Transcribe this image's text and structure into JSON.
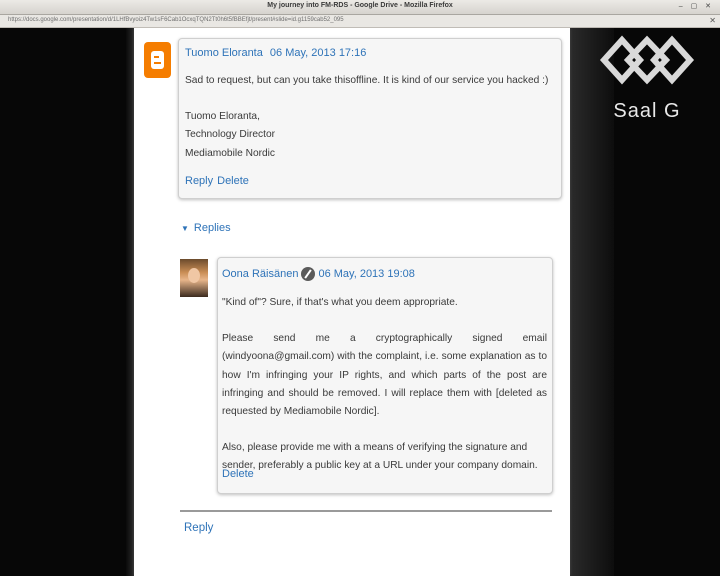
{
  "window": {
    "title": "My journey into FM-RDS - Google Drive - Mozilla Firefox",
    "url": "https://docs.google.com/presentation/d/1LHfBvyoiz4Tw1sF6Cab1OcxqTQN2Tt0h6t5fBBEfjt/present#slide=id.g1159cab52_095"
  },
  "comment": {
    "author": "Tuomo Eloranta",
    "date": "06 May, 2013 17:16",
    "lines": [
      "Sad to request, but can you take thisoffline. It is kind of our service you hacked :)",
      "Tuomo Eloranta,",
      "Technology Director",
      "Mediamobile Nordic"
    ],
    "reply_label": "Reply",
    "delete_label": "Delete"
  },
  "replies": {
    "toggle_label": "Replies",
    "items": [
      {
        "author": "Oona Räisänen",
        "date": "06 May, 2013 19:08",
        "paragraphs": [
          "\"Kind of\"? Sure, if that's what you deem appropriate.",
          "Please send me a cryptographically signed email (windyoona@gmail.com) with the complaint, i.e. some explanation as to how I'm infringing your IP rights, and which parts of the post are infringing and should be removed. I will replace them with [deleted as requested by Mediamobile Nordic].",
          "Also, please provide me with a means of verifying the signature and sender, preferably a public key at a URL under your company domain."
        ],
        "delete_label": "Delete"
      }
    ],
    "reply_label": "Reply"
  },
  "watermark": {
    "text": "Saal G"
  },
  "colors": {
    "link": "#2e73b8",
    "blogger": "#f57d00"
  }
}
